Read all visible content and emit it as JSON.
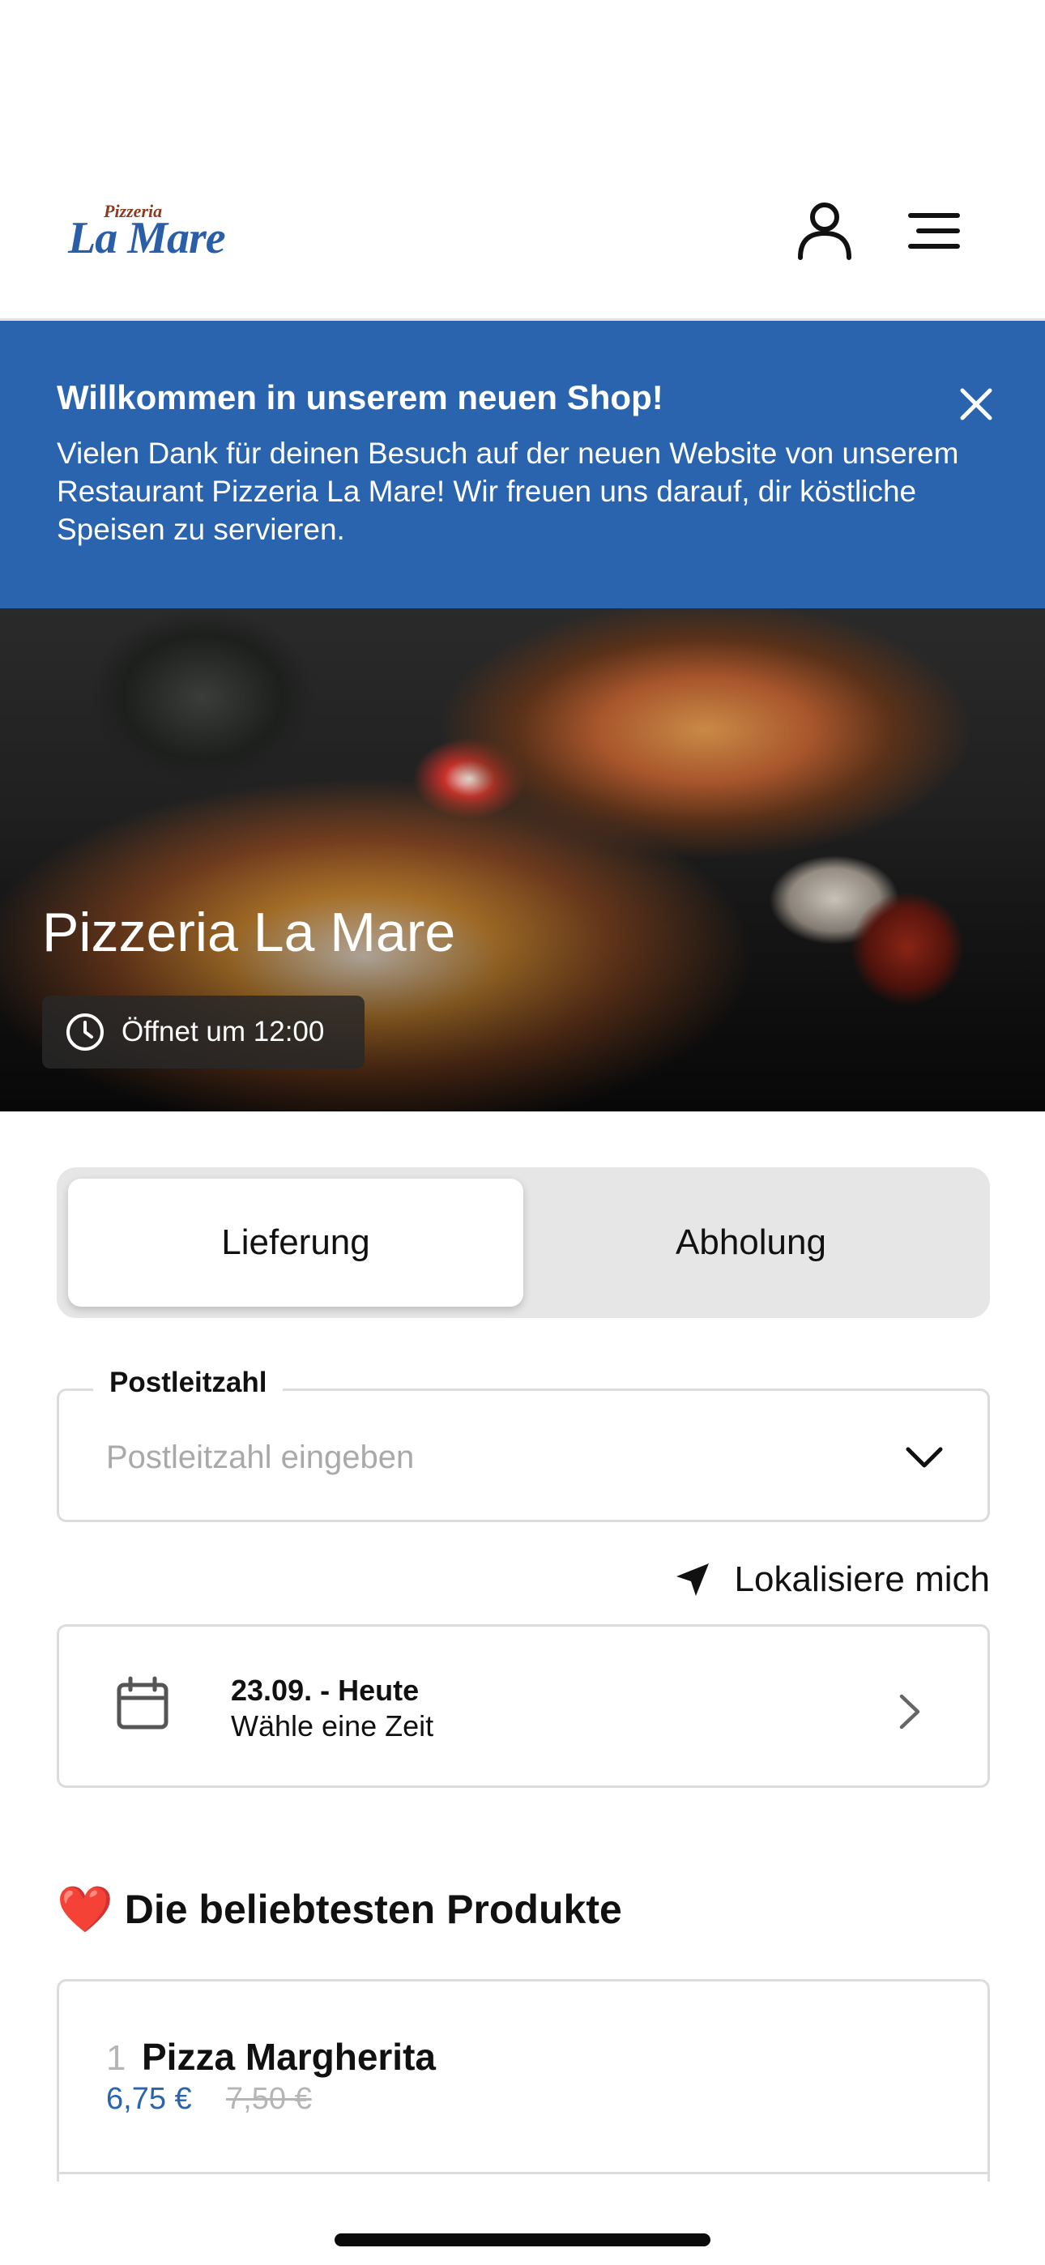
{
  "header": {
    "logo_small": "Pizzeria",
    "logo_main": "La Mare",
    "user_icon": "user-icon",
    "menu_icon": "menu-icon"
  },
  "banner": {
    "title": "Willkommen in unserem neuen Shop!",
    "text": "Vielen Dank für deinen Besuch auf der neuen Website von unserem Restaurant Pizzeria La Mare! Wir freuen uns darauf, dir köstliche Speisen zu servieren.",
    "close_icon": "close-icon",
    "background": "#2a63ae"
  },
  "hero": {
    "title": "Pizzeria La Mare",
    "opening_status": "Öffnet um 12:00",
    "clock_icon": "clock-icon"
  },
  "order_mode": {
    "tabs": [
      {
        "label": "Lieferung",
        "selected": true
      },
      {
        "label": "Abholung",
        "selected": false
      }
    ]
  },
  "postal_code": {
    "label": "Postleitzahl",
    "placeholder": "Postleitzahl eingeben",
    "value": ""
  },
  "locate": {
    "label": "Lokalisiere mich",
    "icon": "location-arrow-icon"
  },
  "time_selector": {
    "date": "23.09. - Heute",
    "subtitle": "Wähle eine Zeit",
    "icon": "calendar-icon"
  },
  "popular": {
    "heart": "❤️",
    "title": "Die beliebtesten Produkte",
    "products": [
      {
        "rank": "1",
        "name": "Pizza Margherita",
        "price": "6,75 €",
        "old_price": "7,50 €"
      }
    ]
  },
  "colors": {
    "accent": "#2a63ae",
    "price": "#2a63ae",
    "muted": "#b5b5b5"
  }
}
